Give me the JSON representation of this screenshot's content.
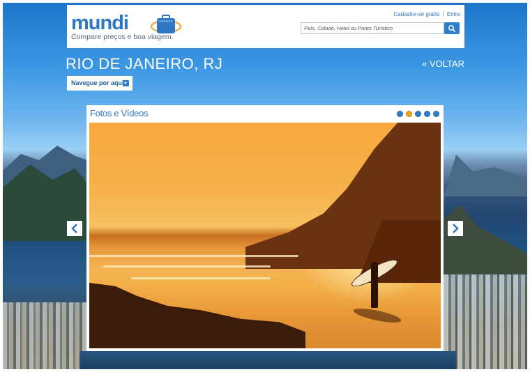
{
  "header": {
    "logo_text": "mundi",
    "logo_tagline": "Compare preços e boa viagem.",
    "top_links": [
      "Cadastre-se grátis",
      "Entre"
    ],
    "search_placeholder": "País, Cidade, Hotel ou Ponto Turístico"
  },
  "page": {
    "city_title": "RIO DE JANEIRO, RJ",
    "back_link": "« VOLTAR",
    "nav_dropdown": "Navegue por aqui"
  },
  "gallery": {
    "title": "Fotos e Vídeos",
    "slide_count": 5,
    "active_slide": 2
  },
  "colors": {
    "brand_blue": "#2f76c4",
    "active_dot": "#f0a020"
  },
  "icons": [
    "suitcase-logo-icon",
    "search-icon",
    "dropdown-arrow-icon",
    "chevron-left-icon",
    "chevron-right-icon"
  ]
}
